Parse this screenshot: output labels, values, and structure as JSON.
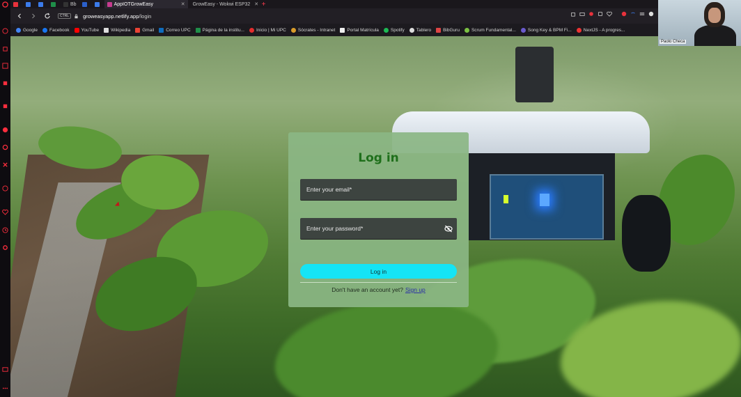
{
  "browser": {
    "tabs": [
      {
        "label": "",
        "color": "#e8323c",
        "active": false
      },
      {
        "label": "",
        "color": "#3b7bea",
        "active": false
      },
      {
        "label": "",
        "color": "#3b7bea",
        "active": false
      },
      {
        "label": "",
        "color": "#1f8e49",
        "active": false
      },
      {
        "label": "Bb",
        "color": "#333",
        "active": false
      },
      {
        "label": "",
        "color": "#2b5fc9",
        "active": false
      },
      {
        "label": "",
        "color": "#3b7bea",
        "active": false
      },
      {
        "label": "AppIOTGrowEasy",
        "color": "#c63b8f",
        "active": true
      },
      {
        "label": "GrowEasy - Wokwi ESP32",
        "color": "#888",
        "active": false
      }
    ],
    "tab_close": "✕",
    "new_tab": "+",
    "url_badge": "CTRL",
    "url_host": "groweasyapp.netlify.app",
    "url_path": "/login",
    "bookmarks": [
      {
        "label": "Google",
        "color": "#4285f4"
      },
      {
        "label": "Facebook",
        "color": "#1877f2"
      },
      {
        "label": "YouTube",
        "color": "#ff0000"
      },
      {
        "label": "Wikipedia",
        "color": "#dddddd"
      },
      {
        "label": "Gmail",
        "color": "#ea4335"
      },
      {
        "label": "Correo UPC",
        "color": "#0f6cbd"
      },
      {
        "label": "Página de la institu...",
        "color": "#1f8e49"
      },
      {
        "label": "Inicio | Mi UPC",
        "color": "#e32d2d"
      },
      {
        "label": "Sócrates - Intranet",
        "color": "#d99c2a"
      },
      {
        "label": "Portal Matrícula",
        "color": "#eeeeee"
      },
      {
        "label": "Spotify",
        "color": "#1db954"
      },
      {
        "label": "Tablero",
        "color": "#dddddd"
      },
      {
        "label": "BibGuru",
        "color": "#d44"
      },
      {
        "label": "Scrum Fundamental...",
        "color": "#7bc043"
      },
      {
        "label": "Song Key & BPM Fi...",
        "color": "#6a5acd"
      },
      {
        "label": "NextJS - A progres...",
        "color": "#e33"
      }
    ]
  },
  "login": {
    "title": "Log in",
    "email_placeholder": "Enter your email*",
    "password_placeholder": "Enter your password*",
    "button_label": "Log in",
    "signup_prompt": "Don't have an account yet?",
    "signup_link": "Sign up"
  },
  "webcam": {
    "name": "Paolo Checa"
  },
  "colors": {
    "card_bg": "#8bb684",
    "title": "#1f6f1b",
    "button": "#15e4f5",
    "link": "#2a2fa6",
    "accent": "#ff3b4e"
  }
}
